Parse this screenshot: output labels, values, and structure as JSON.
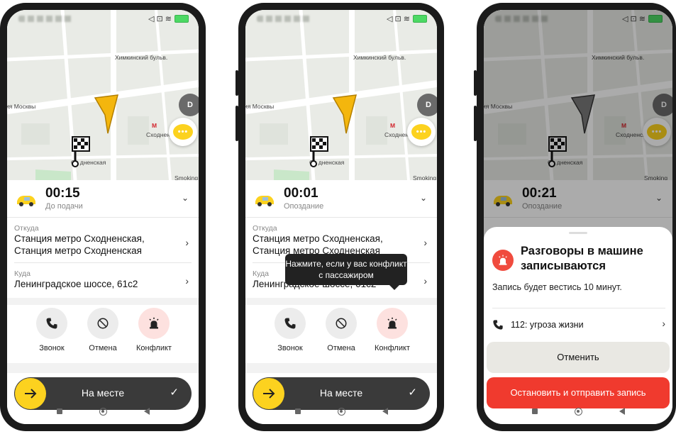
{
  "map": {
    "street_label": "Химкинский бульв.",
    "area_label": "ия Москвы",
    "metro_label": "Сходненская",
    "metro_badge": "М",
    "flag_label": "Сх  дненская",
    "corner_label": "Smoking",
    "avatar_letter": "D",
    "chat_dots": "•••"
  },
  "status": {
    "icons": "◁ ⊡ ≋"
  },
  "screens": [
    {
      "timer": "00:15",
      "timer_sub": "До подачи",
      "from_label": "Откуда",
      "from_value": "Станция метро Сходненская, Станция метро Сходненская",
      "to_label": "Куда",
      "to_value": "Ленинградское шоссе, 61с2",
      "call_label": "Звонок",
      "cancel_label": "Отмена",
      "conflict_label": "Конфликт",
      "slider_label": "На месте"
    },
    {
      "timer": "00:01",
      "timer_sub": "Опоздание",
      "from_label": "Откуда",
      "from_value": "Станция метро Сходненская, Станция метро Сходненская",
      "to_label": "Куда",
      "to_value": "Ленинградское шоссе, 61с2",
      "call_label": "Звонок",
      "cancel_label": "Отмена",
      "conflict_label": "Конфликт",
      "slider_label": "На месте",
      "tooltip": "Нажмите, если у вас конфликт с пассажиром"
    },
    {
      "timer": "00:21",
      "timer_sub": "Опоздание",
      "modal_title": "Разговоры в машине записываются",
      "modal_desc": "Запись будет вестись 10 минут.",
      "sos_label": "112: угроза жизни",
      "cancel_button": "Отменить",
      "stop_button": "Остановить и отправить запись"
    }
  ],
  "colors": {
    "accent_yellow": "#fcd21f",
    "danger_red": "#f03a2e",
    "slider_dark": "#3a3a3a"
  }
}
